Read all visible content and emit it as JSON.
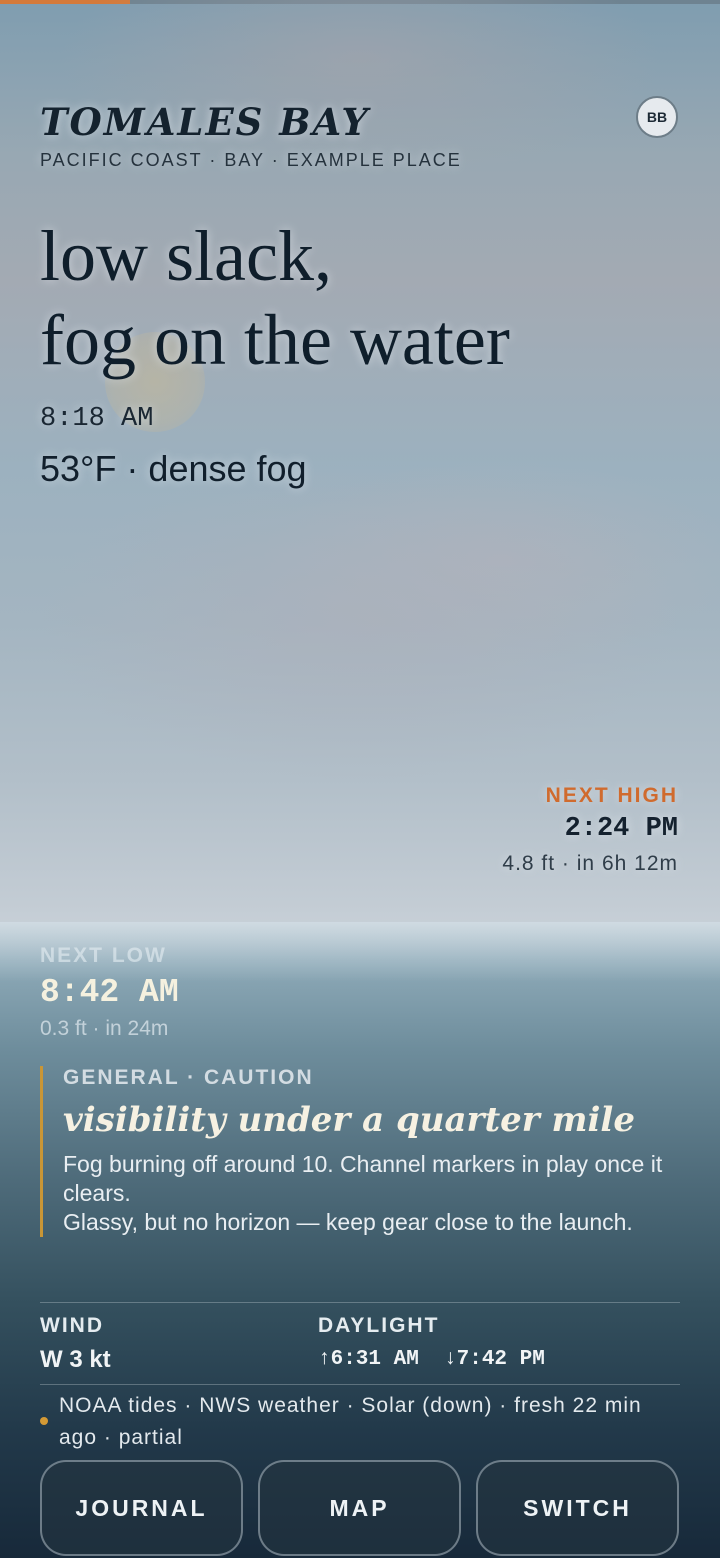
{
  "location": {
    "title": "TOMALES BAY",
    "subtitle": "PACIFIC COAST · BAY · EXAMPLE PLACE",
    "avatar_initials": "BB"
  },
  "conditions": {
    "headline_line1": "low slack,",
    "headline_line2": "fog on the water",
    "time": "8:18 AM",
    "weather": "53°F · dense fog"
  },
  "tides": {
    "next_high": {
      "label": "NEXT HIGH",
      "time": "2:24 PM",
      "detail": "4.8 ft · in 6h 12m"
    },
    "next_low": {
      "label": "NEXT LOW",
      "time": "8:42 AM",
      "detail": "0.3 ft · in 24m"
    },
    "cycle_progress": 0.18
  },
  "advisory": {
    "tag": "GENERAL · CAUTION",
    "title": "visibility under a quarter mile",
    "line1": "Fog burning off around 10. Channel markers in play once it clears.",
    "line2": "Glassy, but no horizon — keep gear close to the launch."
  },
  "stats": {
    "wind_label": "WIND",
    "wind_value": "W 3 kt",
    "daylight_label": "DAYLIGHT",
    "daylight_value": "↑6:31 AM  ↓7:42 PM"
  },
  "sources": {
    "text": "NOAA tides · NWS weather · Solar (down) · fresh 22 min ago · partial",
    "status_color": "#d49a35"
  },
  "actions": {
    "journal": "JOURNAL",
    "map": "MAP",
    "switch": "SWITCH"
  },
  "colors": {
    "accent_orange": "#d06b2e",
    "advisory_border": "#c99636"
  }
}
